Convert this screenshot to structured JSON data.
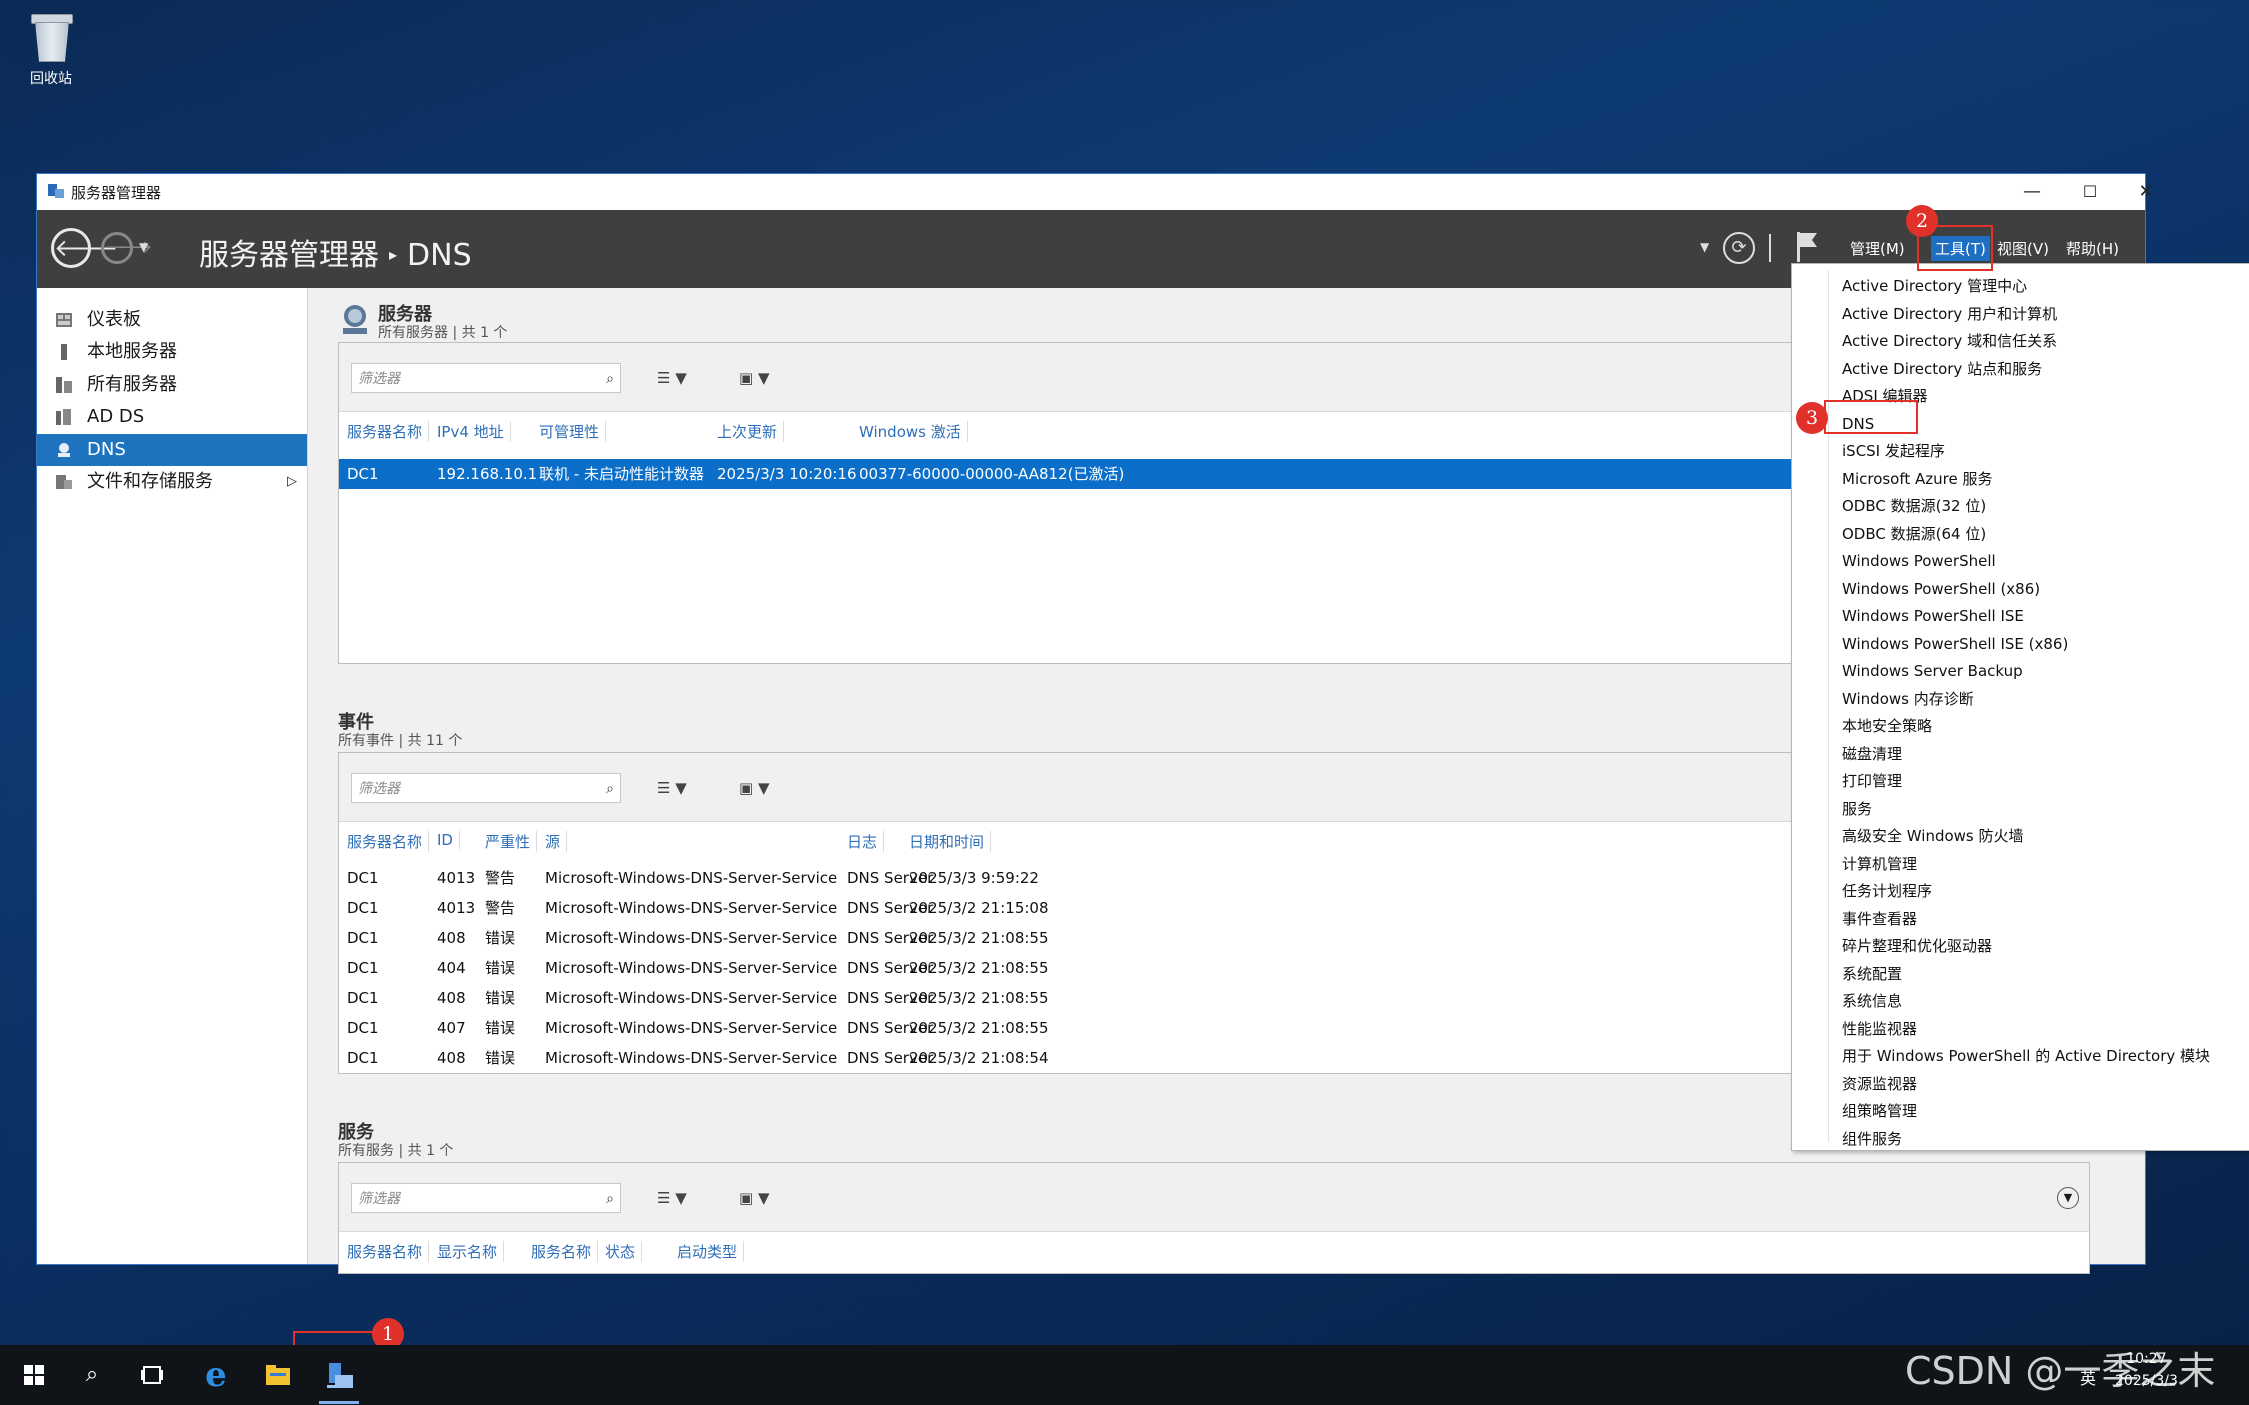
{
  "desktop": {
    "recycle_bin_label": "回收站"
  },
  "window": {
    "title": "服务器管理器",
    "controls": {
      "minimize": "—",
      "maximize": "☐",
      "close": "✕"
    }
  },
  "navbar": {
    "breadcrumb_root": "服务器管理器",
    "breadcrumb_separator": "▸",
    "breadcrumb_current": "DNS",
    "menus": [
      "管理(M)",
      "工具(T)",
      "视图(V)",
      "帮助(H)"
    ]
  },
  "sidebar": {
    "items": [
      {
        "label": "仪表板",
        "icon": "dashboard-icon"
      },
      {
        "label": "本地服务器",
        "icon": "local-server-icon"
      },
      {
        "label": "所有服务器",
        "icon": "all-servers-icon"
      },
      {
        "label": "AD DS",
        "icon": "ad-ds-icon"
      },
      {
        "label": "DNS",
        "icon": "dns-icon"
      },
      {
        "label": "文件和存储服务",
        "icon": "storage-icon"
      }
    ],
    "expand_arrow": "▷"
  },
  "servers": {
    "title": "服务器",
    "subtitle": "所有服务器 | 共 1 个",
    "filter_placeholder": "筛选器",
    "columns": [
      "服务器名称",
      "IPv4 地址",
      "可管理性",
      "上次更新",
      "Windows 激活"
    ],
    "rows": [
      [
        "DC1",
        "192.168.10.1",
        "联机 - 未启动性能计数器",
        "2025/3/3 10:20:16",
        "00377-60000-00000-AA812(已激活)"
      ]
    ]
  },
  "events": {
    "title": "事件",
    "subtitle": "所有事件 | 共 11 个",
    "filter_placeholder": "筛选器",
    "columns": [
      "服务器名称",
      "ID",
      "严重性",
      "源",
      "日志",
      "日期和时间"
    ],
    "rows": [
      [
        "DC1",
        "4013",
        "警告",
        "Microsoft-Windows-DNS-Server-Service",
        "DNS Server",
        "2025/3/3 9:59:22"
      ],
      [
        "DC1",
        "4013",
        "警告",
        "Microsoft-Windows-DNS-Server-Service",
        "DNS Server",
        "2025/3/2 21:15:08"
      ],
      [
        "DC1",
        "408",
        "错误",
        "Microsoft-Windows-DNS-Server-Service",
        "DNS Server",
        "2025/3/2 21:08:55"
      ],
      [
        "DC1",
        "404",
        "错误",
        "Microsoft-Windows-DNS-Server-Service",
        "DNS Server",
        "2025/3/2 21:08:55"
      ],
      [
        "DC1",
        "408",
        "错误",
        "Microsoft-Windows-DNS-Server-Service",
        "DNS Server",
        "2025/3/2 21:08:55"
      ],
      [
        "DC1",
        "407",
        "错误",
        "Microsoft-Windows-DNS-Server-Service",
        "DNS Server",
        "2025/3/2 21:08:55"
      ],
      [
        "DC1",
        "408",
        "错误",
        "Microsoft-Windows-DNS-Server-Service",
        "DNS Server",
        "2025/3/2 21:08:54"
      ]
    ]
  },
  "services": {
    "title": "服务",
    "subtitle": "所有服务 | 共 1 个",
    "filter_placeholder": "筛选器",
    "columns": [
      "服务器名称",
      "显示名称",
      "服务名称",
      "状态",
      "启动类型"
    ]
  },
  "tools_menu": {
    "items": [
      "Active Directory 管理中心",
      "Active Directory 用户和计算机",
      "Active Directory 域和信任关系",
      "Active Directory 站点和服务",
      "ADSI 编辑器",
      "DNS",
      "iSCSI 发起程序",
      "Microsoft Azure 服务",
      "ODBC 数据源(32 位)",
      "ODBC 数据源(64 位)",
      "Windows PowerShell",
      "Windows PowerShell (x86)",
      "Windows PowerShell ISE",
      "Windows PowerShell ISE (x86)",
      "Windows Server Backup",
      "Windows 内存诊断",
      "本地安全策略",
      "磁盘清理",
      "打印管理",
      "服务",
      "高级安全 Windows 防火墙",
      "计算机管理",
      "任务计划程序",
      "事件查看器",
      "碎片整理和优化驱动器",
      "系统配置",
      "系统信息",
      "性能监视器",
      "用于 Windows PowerShell 的 Active Directory 模块",
      "资源监视器",
      "组策略管理",
      "组件服务"
    ]
  },
  "annotations": [
    "1",
    "2",
    "3"
  ],
  "taskbar": {
    "clock_time": "10:27",
    "clock_date": "2025/3/3",
    "ime": "英"
  },
  "watermark": "CSDN @一季之末",
  "colors": {
    "accent": "#1e73be",
    "navbar": "#3f3f3f",
    "annotation": "#e0322b"
  }
}
